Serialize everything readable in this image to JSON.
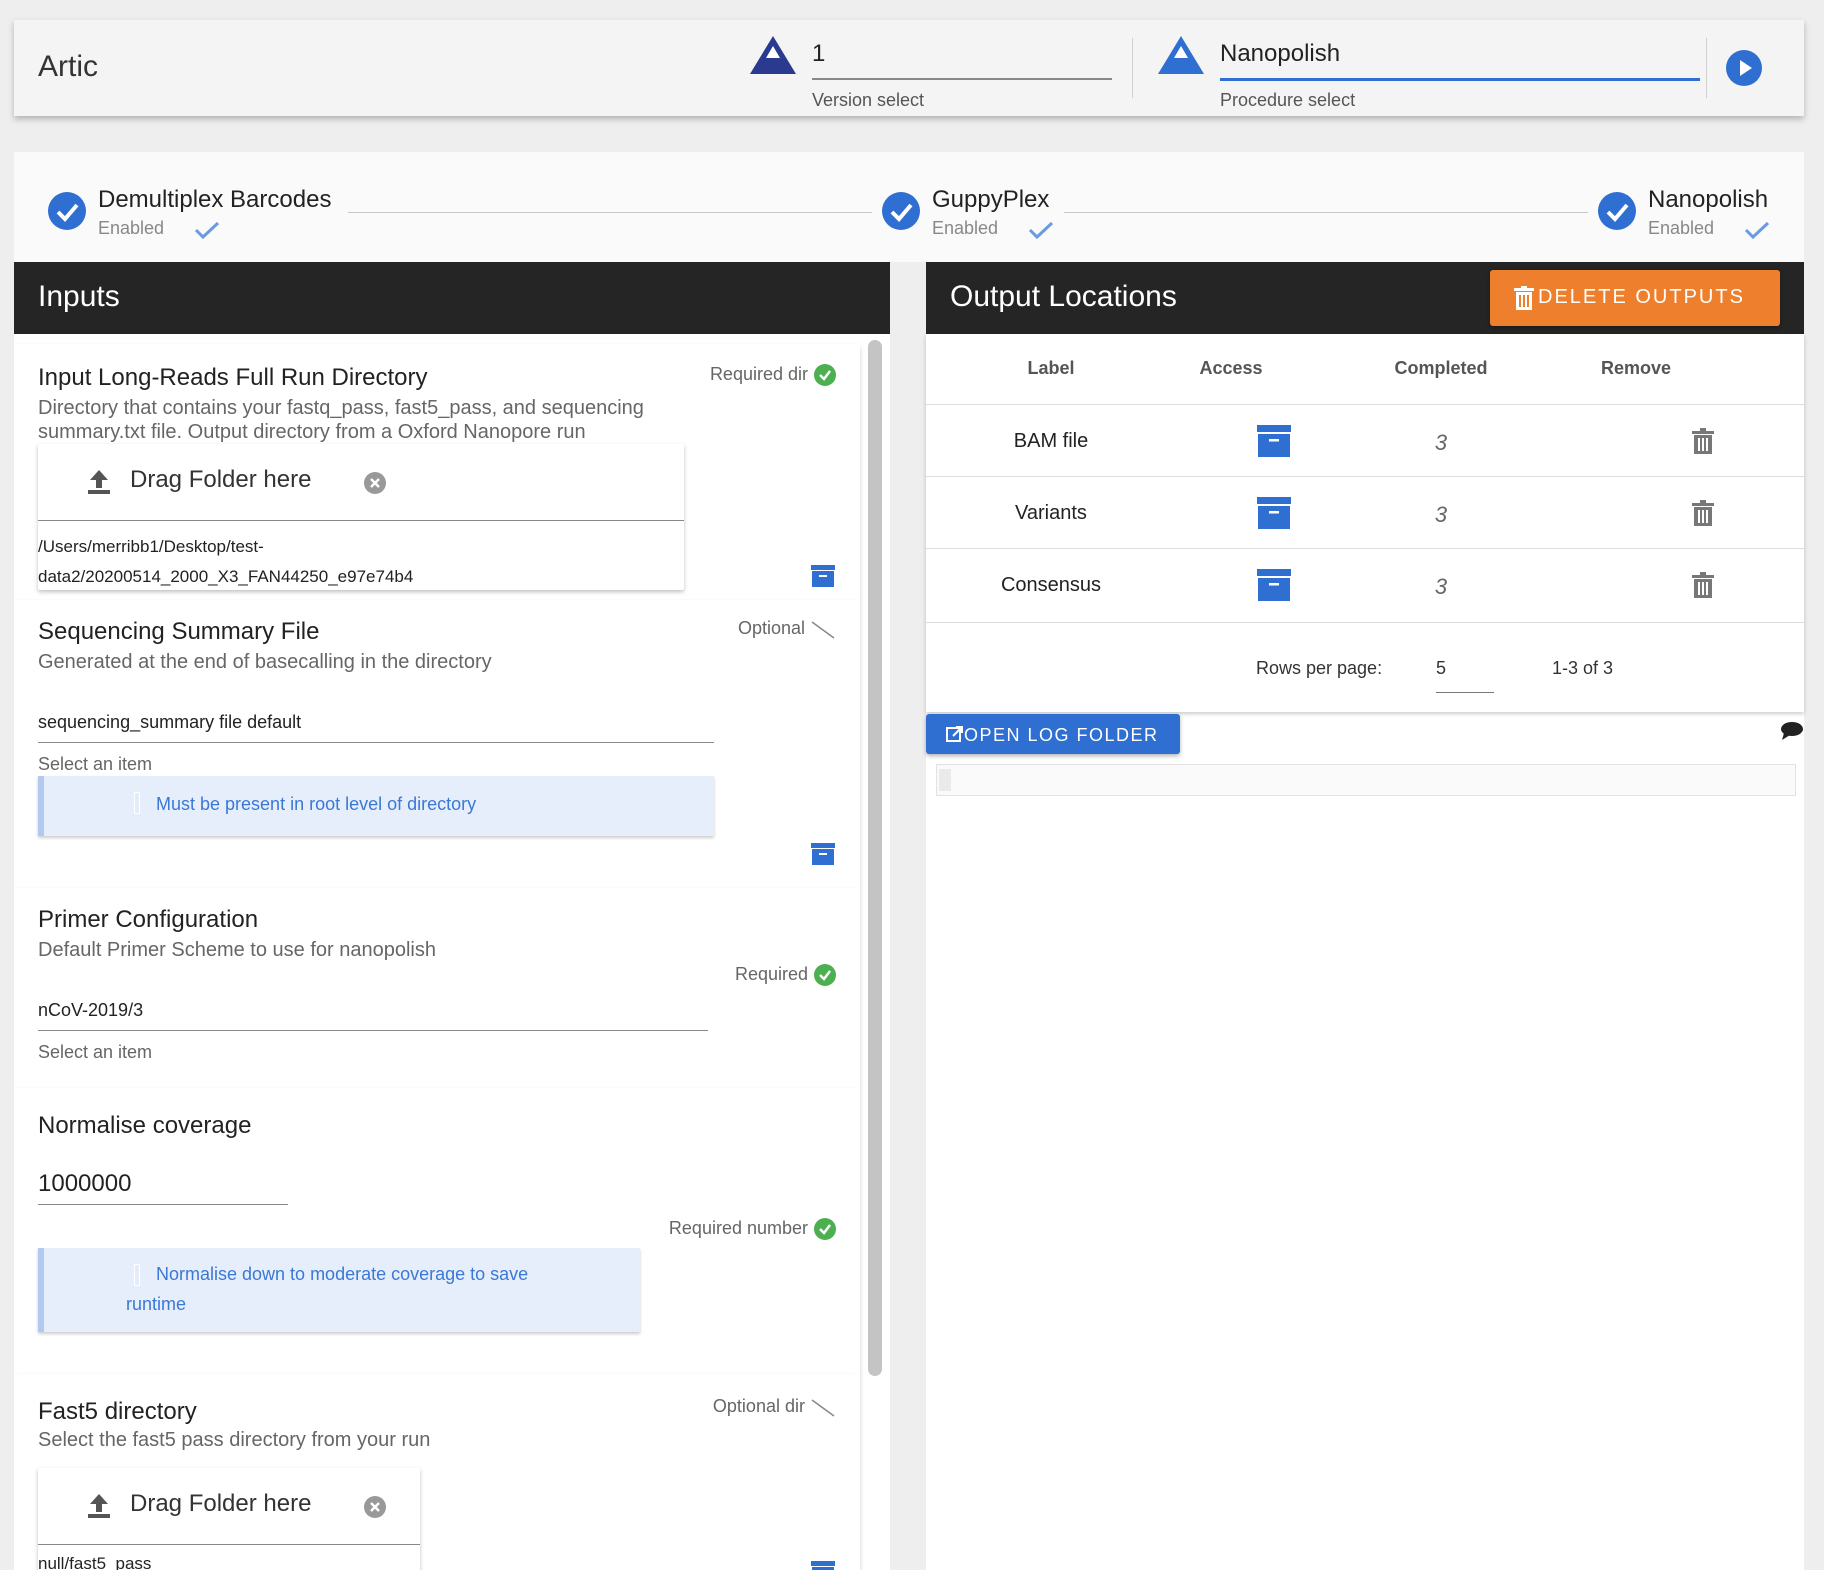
{
  "app": {
    "title": "Artic"
  },
  "version_select": {
    "value": "1",
    "label": "Version select"
  },
  "procedure_select": {
    "value": "Nanopolish",
    "label": "Procedure select"
  },
  "steps": [
    {
      "title": "Demultiplex Barcodes",
      "status": "Enabled"
    },
    {
      "title": "GuppyPlex",
      "status": "Enabled"
    },
    {
      "title": "Nanopolish",
      "status": "Enabled"
    }
  ],
  "inputs": {
    "header": "Inputs",
    "cards": {
      "long_reads": {
        "title": "Input Long-Reads Full Run Directory",
        "desc_line1": "Directory that contains your fastq_pass, fast5_pass, and sequencing",
        "desc_line2": "summary.txt file. Output directory from a Oxford Nanopore run",
        "requirement": "Required dir",
        "drop_label": "Drag Folder here",
        "path_line1": "/Users/merribb1/Desktop/test-",
        "path_line2": "data2/20200514_2000_X3_FAN44250_e97e74b4"
      },
      "seq_summary": {
        "title": "Sequencing Summary File",
        "desc": "Generated at the end of basecalling in the directory",
        "requirement": "Optional",
        "value": "sequencing_summary file default",
        "hint": "Select an item",
        "alert": "Must be present in root level of directory"
      },
      "primer": {
        "title": "Primer Configuration",
        "desc": "Default Primer Scheme to use for nanopolish",
        "requirement": "Required",
        "value": "nCoV-2019/3",
        "hint": "Select an item"
      },
      "normalise": {
        "title": "Normalise coverage",
        "value": "1000000",
        "requirement": "Required number",
        "alert_line1": "Normalise down to moderate coverage to save",
        "alert_line2": "runtime"
      },
      "fast5": {
        "title": "Fast5 directory",
        "desc": "Select the fast5 pass directory from your run",
        "requirement": "Optional dir",
        "drop_label": "Drag Folder here",
        "path": "null/fast5_pass"
      }
    }
  },
  "outputs": {
    "header": "Output Locations",
    "delete_label": "DELETE OUTPUTS",
    "columns": [
      "Label",
      "Access",
      "Completed",
      "Remove"
    ],
    "rows": [
      {
        "label": "BAM file",
        "completed": "3"
      },
      {
        "label": "Variants",
        "completed": "3"
      },
      {
        "label": "Consensus",
        "completed": "3"
      }
    ],
    "rows_per_page_label": "Rows per page:",
    "rows_per_page": "5",
    "range": "1-3 of 3",
    "open_log_label": "OPEN LOG FOLDER"
  },
  "colors": {
    "accent_blue": "#2f6fd1",
    "delete_orange": "#ee7f2c",
    "header_dark": "#252525",
    "ok_green": "#4caf50"
  },
  "icons": [
    "artic-logo-icon",
    "play-icon",
    "check-circle-icon",
    "checkmark-icon",
    "upload-icon",
    "clear-icon",
    "archive-icon",
    "trash-icon",
    "external-link-icon",
    "chat-icon"
  ]
}
